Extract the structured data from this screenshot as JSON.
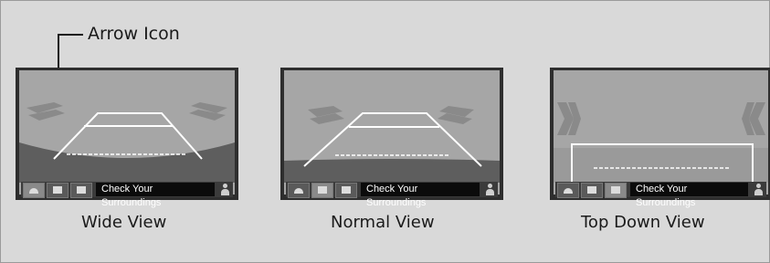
{
  "callout": {
    "label": "Arrow Icon",
    "icon": "arrow-icon"
  },
  "status_bar": {
    "message": "Check Your Surroundings"
  },
  "views": [
    {
      "caption": "Wide View"
    },
    {
      "caption": "Normal View"
    },
    {
      "caption": "Top Down View"
    }
  ],
  "colors": {
    "background": "#d9d9d9",
    "screen_sky": "#a6a6a6",
    "screen_ground": "#5e5e5e",
    "guide_lines": "#ffffff",
    "status_bar": "#0b0b0b"
  }
}
